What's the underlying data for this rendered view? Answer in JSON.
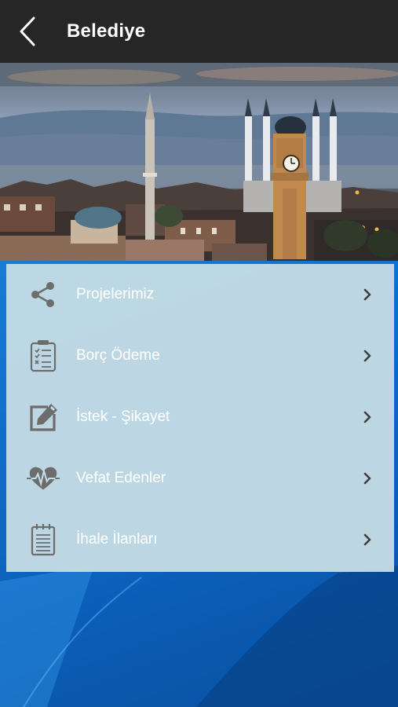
{
  "header": {
    "title": "Belediye",
    "back_icon": "chevron-left-icon"
  },
  "hero": {
    "description_icon": "city-skyline-photo"
  },
  "menu": {
    "items": [
      {
        "label": "Projelerimiz",
        "icon": "share-icon"
      },
      {
        "label": "Borç Ödeme",
        "icon": "clipboard-checklist-icon"
      },
      {
        "label": "İstek - Şikayet",
        "icon": "edit-icon"
      },
      {
        "label": "Vefat Edenler",
        "icon": "heartbeat-icon"
      },
      {
        "label": "İhale İlanları",
        "icon": "notepad-icon"
      }
    ]
  },
  "colors": {
    "topbar": "#262626",
    "menu_bg": "#c4dce4",
    "icon": "#6d6d6d",
    "text": "#ffffff",
    "background_blue": "#1273cf"
  }
}
